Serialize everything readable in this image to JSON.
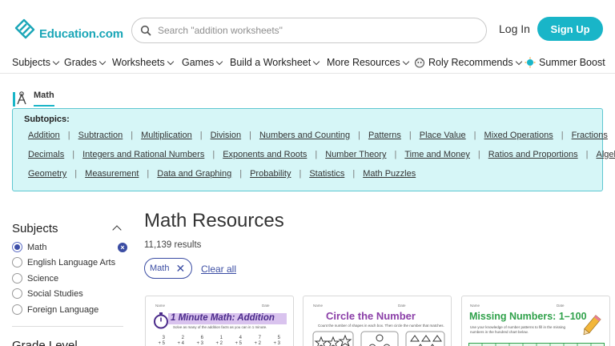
{
  "header": {
    "logo_text": "Education.com",
    "search_placeholder": "Search \"addition worksheets\"",
    "login_label": "Log In",
    "signup_label": "Sign Up"
  },
  "nav": {
    "items": [
      {
        "label": "Subjects"
      },
      {
        "label": "Grades"
      },
      {
        "label": "Worksheets"
      },
      {
        "label": "Games"
      },
      {
        "label": "Build a Worksheet"
      },
      {
        "label": "More Resources"
      },
      {
        "label": "Roly Recommends"
      },
      {
        "label": "Summer Boost"
      }
    ]
  },
  "math_tab": {
    "label": "Math"
  },
  "subtopics": {
    "title": "Subtopics:",
    "rows": [
      [
        "Addition",
        "Subtraction",
        "Multiplication",
        "Division",
        "Numbers and Counting",
        "Patterns",
        "Place Value",
        "Mixed Operations",
        "Fractions"
      ],
      [
        "Decimals",
        "Integers and Rational Numbers",
        "Exponents and Roots",
        "Number Theory",
        "Time and Money",
        "Ratios and Proportions",
        "Algebra"
      ],
      [
        "Geometry",
        "Measurement",
        "Data and Graphing",
        "Probability",
        "Statistics",
        "Math Puzzles"
      ]
    ]
  },
  "sidebar": {
    "subjects_title": "Subjects",
    "items": [
      {
        "label": "Math",
        "selected": true
      },
      {
        "label": "English Language Arts",
        "selected": false
      },
      {
        "label": "Science",
        "selected": false
      },
      {
        "label": "Social Studies",
        "selected": false
      },
      {
        "label": "Foreign Language",
        "selected": false
      }
    ],
    "clear_symbol": "×",
    "grade_title": "Grade Level"
  },
  "main": {
    "title": "Math Resources",
    "results": "11,139 results",
    "chip_label": "Math",
    "chip_remove": "✕",
    "clear_all": "Clear all"
  },
  "cards": [
    {
      "title": "1 Minute Math: Addition",
      "subtitle": "Solve as many of the addition facts as you can in 1 minute.",
      "name_label": "Name",
      "date_label": "Date",
      "title_color": "#4a2a8a",
      "highlight": "#d9c3ee"
    },
    {
      "title": "Circle the Number",
      "subtitle": "Count the number of shapes in each box. Then circle the number that matches.",
      "name_label": "Name",
      "date_label": "Date",
      "title_color": "#8b3fa8"
    },
    {
      "title": "Missing Numbers: 1–100",
      "subtitle": "Use your knowledge of number patterns to fill in the missing numbers in the hundred chart below.",
      "name_label": "Name",
      "date_label": "Date",
      "title_color": "#2fa14a"
    }
  ],
  "colors": {
    "brand": "#19b5c8",
    "accent": "#3b4da3",
    "subtopic_bg": "#d6f6f7"
  }
}
